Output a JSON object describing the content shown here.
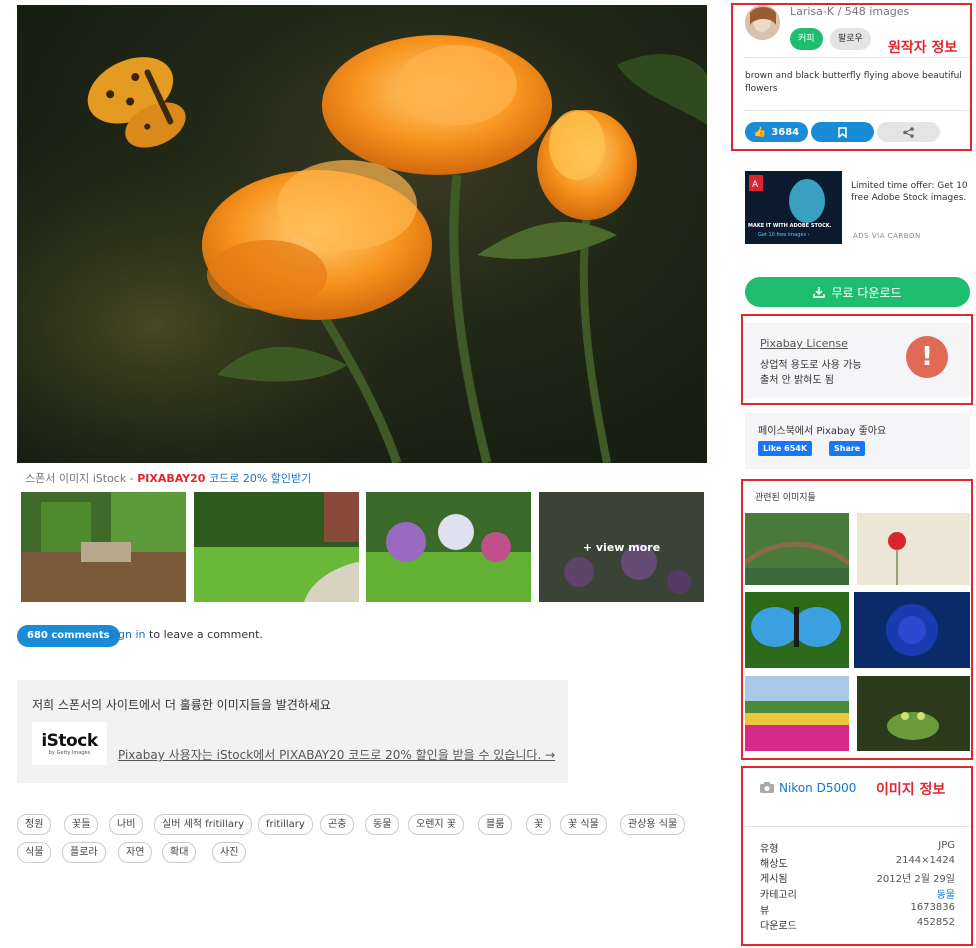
{
  "main": {
    "sponsor_prefix": "스폰서 이미지 iStock - ",
    "sponsor_code": "PIXABAY20",
    "sponsor_suffix": " 코드로 20% 할인받기",
    "view_more": "+ view more",
    "comments_badge": "680 comments",
    "sign_in": "Sign in",
    "sign_in_suffix": " to leave a comment.",
    "istock_title": "저희 스폰서의 사이트에서 더 훌륭한 이미지들을 발견하세요",
    "istock_logo_main": "iStock",
    "istock_logo_sub": "by Getty Images",
    "istock_link": "Pixabay 사용자는 iStock에서 PIXABAY20 코드로 20% 할인을 받을 수 있습니다. →",
    "tags": [
      "정원",
      "꽃들",
      "나비",
      "실버 세척 fritillary",
      "fritillary",
      "곤충",
      "동물",
      "오렌지 꽃",
      "블룸",
      "꽃",
      "꽃 식물",
      "관상용 식물",
      "식물",
      "플로라",
      "자연",
      "확대",
      "사진"
    ]
  },
  "sidebar": {
    "author": "Larisa-K / 548 images",
    "follow_label": "커피",
    "follow2_label": "팔로우",
    "annotation_author": "원작자 정보",
    "description": "brown and black butterfly flying above beautiful flowers",
    "like_count": "3684",
    "ad_image_l1": "MAKE IT WITH ADOBE STOCK.",
    "ad_image_l2": "Get 10 free images ›",
    "ad_text": "Limited time offer: Get 10 free Adobe Stock images.",
    "ad_via": "ADS VIA CARBON",
    "download_label": "무료 다운로드",
    "license_title": "Pixabay License",
    "license_l2": "상업적 용도로 사용 가능",
    "license_l3": "출처 안 밝혀도 됨",
    "license_mark": "!",
    "fb_title": "페이스북에서 Pixabay 좋아요",
    "fb_like": "Like 654K",
    "fb_share": "Share",
    "related_title": "관련된 이미지들",
    "camera_model": "Nikon D5000",
    "annotation_info": "이미지 정보",
    "info": [
      {
        "k": "유형",
        "v": "JPG"
      },
      {
        "k": "해상도",
        "v": "2144×1424"
      },
      {
        "k": "게시됨",
        "v": "2012년 2월 29일"
      },
      {
        "k": "카테고리",
        "v": "동물"
      },
      {
        "k": "뷰",
        "v": "1673836"
      },
      {
        "k": "다운로드",
        "v": "452852"
      }
    ]
  },
  "colors": {
    "accent_green": "#1fbd6f",
    "accent_blue": "#1a8bd6",
    "annotation_red": "#e3262e"
  },
  "icons": {
    "like": "thumbs-up-icon",
    "bookmark": "bookmark-icon",
    "share": "share-icon",
    "download": "download-icon",
    "camera": "camera-icon",
    "license": "exclamation-icon"
  }
}
